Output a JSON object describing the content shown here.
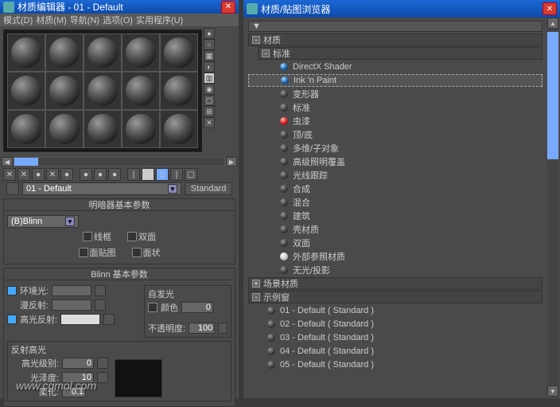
{
  "left": {
    "title": "材质编辑器 - 01 - Default",
    "menu": [
      "模式(D)",
      "材质(M)",
      "导航(N)",
      "选项(O)",
      "实用程序(U)"
    ],
    "slot_count": 15,
    "side_tool_count": 9,
    "toolbar_icons": [
      "✕",
      "✕",
      "●",
      "✕",
      "●",
      "",
      "●",
      "●",
      "●",
      "",
      "|",
      "▦",
      "▯",
      "|",
      "▢"
    ],
    "material_name": "01 - Default",
    "material_type": "Standard",
    "rollouts": {
      "shader": {
        "title": "明暗器基本参数",
        "shader_dropdown": "(B)Blinn",
        "checkboxes": {
          "wire": "线框",
          "twosided": "双面",
          "facemap": "面贴图",
          "faceted": "面状"
        }
      },
      "blinn": {
        "title": "Blinn 基本参数",
        "self_illum": "自发光",
        "ambient": "环境光:",
        "diffuse": "漫反射:",
        "specular": "高光反射:",
        "color_cb": "颜色",
        "color_val": "0",
        "opacity": "不透明度:",
        "opacity_val": "100",
        "spec_hdr": "反射高光",
        "spec_level": "高光级别:",
        "spec_level_val": "0",
        "glossiness": "光泽度:",
        "glossiness_val": "10",
        "soften": "柔化:",
        "soften_val": "0.1"
      }
    }
  },
  "right": {
    "title": "材质/贴图浏览器",
    "sections": {
      "material": {
        "label": "材质",
        "expanded": true
      },
      "standard": {
        "label": "标准",
        "items": [
          {
            "name": "DirectX Shader",
            "color": "blue"
          },
          {
            "name": "Ink 'n Paint",
            "color": "blue",
            "sel": true
          },
          {
            "name": "变形器",
            "color": "default"
          },
          {
            "name": "标准",
            "color": "default"
          },
          {
            "name": "虫漆",
            "color": "red"
          },
          {
            "name": "顶/底",
            "color": "default"
          },
          {
            "name": "多维/子对象",
            "color": "default"
          },
          {
            "name": "高级照明覆盖",
            "color": "default"
          },
          {
            "name": "光线跟踪",
            "color": "default"
          },
          {
            "name": "合成",
            "color": "default"
          },
          {
            "name": "混合",
            "color": "default"
          },
          {
            "name": "建筑",
            "color": "default"
          },
          {
            "name": "壳材质",
            "color": "default"
          },
          {
            "name": "双面",
            "color": "default"
          },
          {
            "name": "外部参照材质",
            "color": "white"
          },
          {
            "name": "无光/投影",
            "color": "default"
          }
        ]
      },
      "scene": {
        "label": "场景材质"
      },
      "sample": {
        "label": "示例窗",
        "items": [
          "01 - Default ( Standard )",
          "02 - Default ( Standard )",
          "03 - Default ( Standard )",
          "04 - Default ( Standard )",
          "05 - Default ( Standard )"
        ]
      }
    }
  },
  "watermark": "www.cgmol.com"
}
